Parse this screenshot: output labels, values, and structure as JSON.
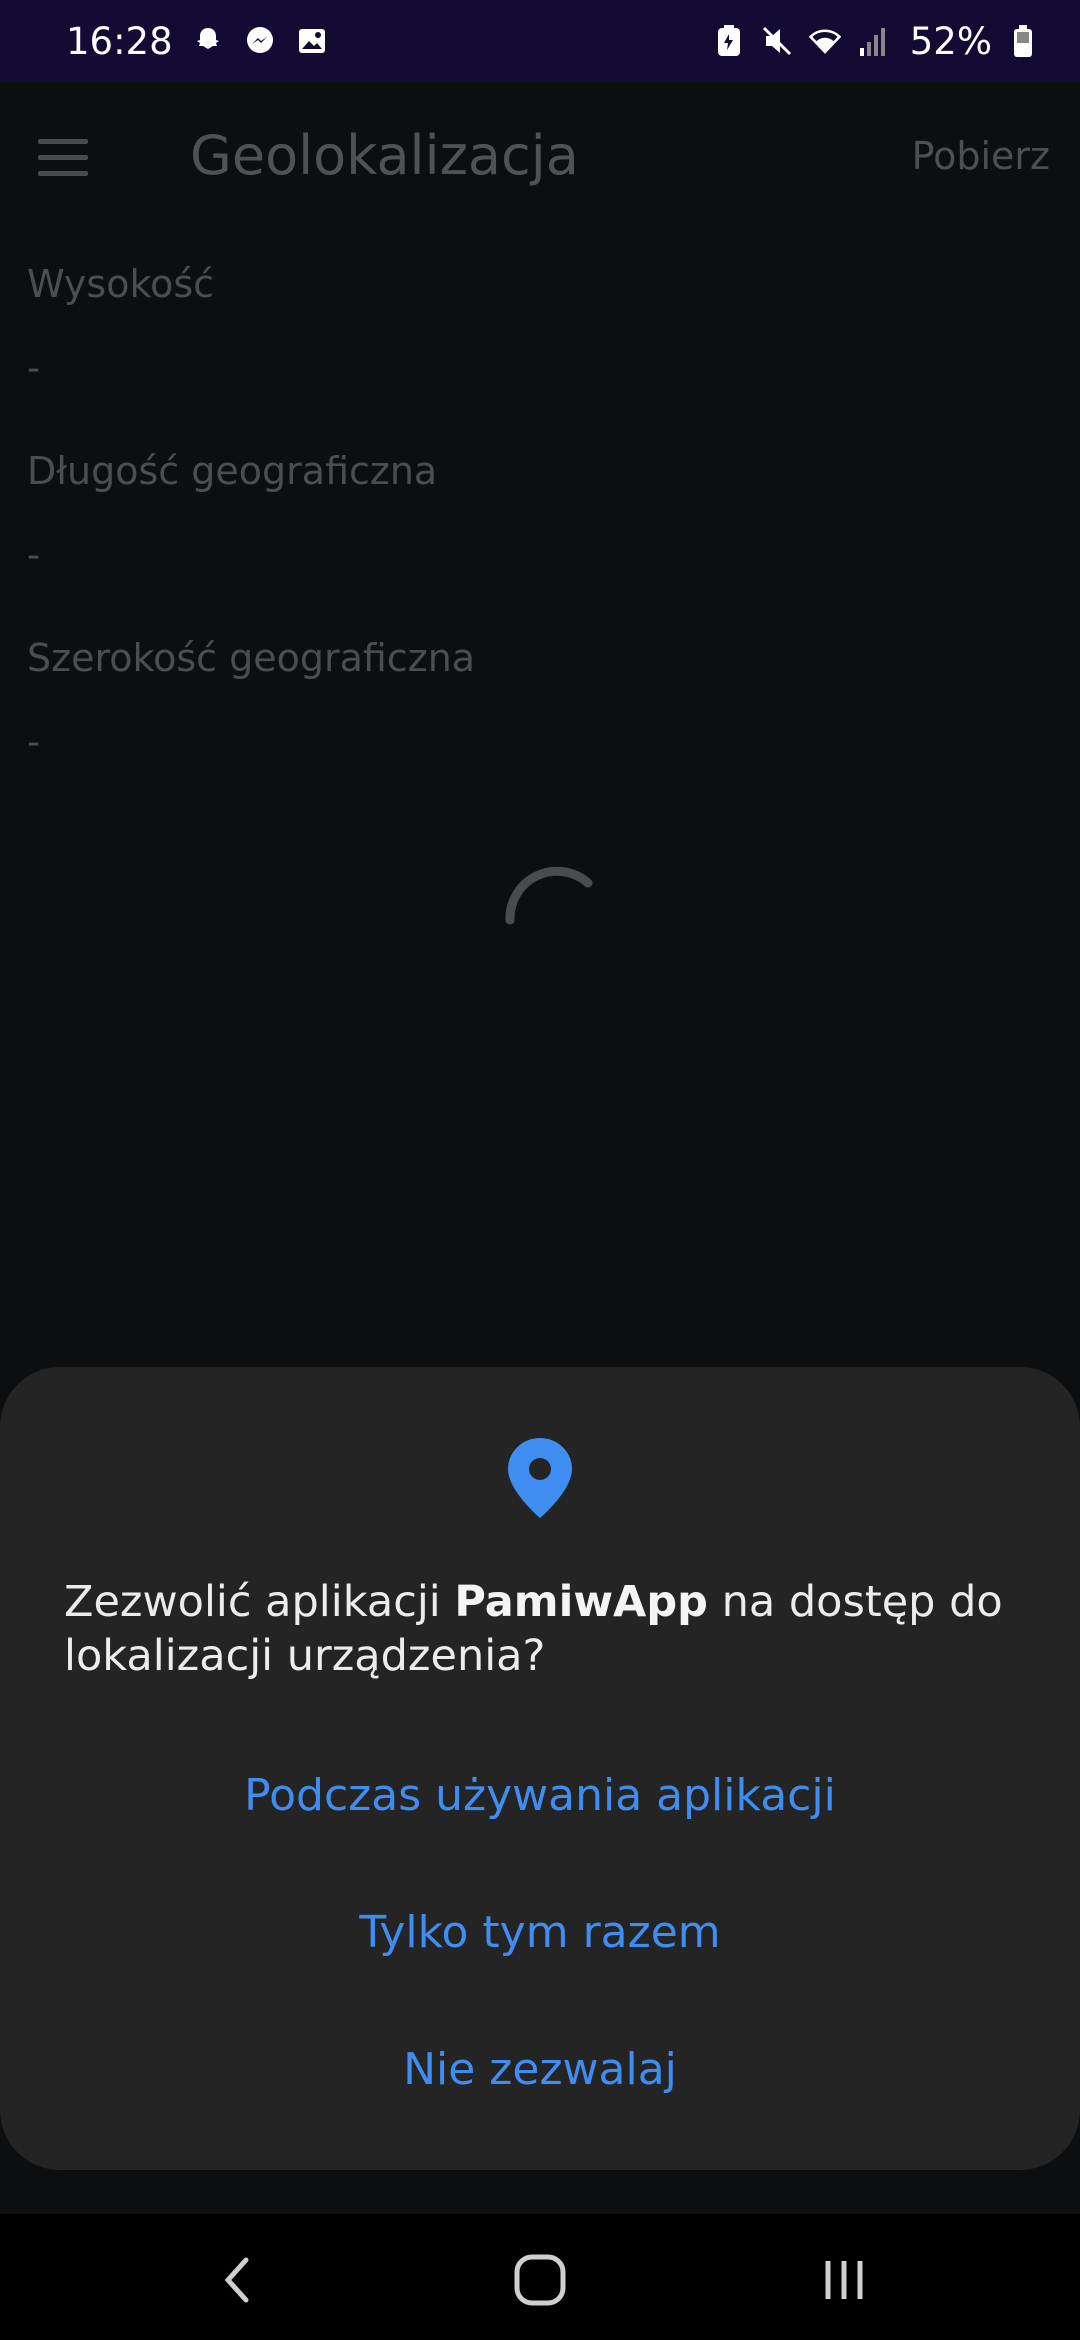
{
  "status_bar": {
    "time": "16:28",
    "battery_percent": "52%",
    "icons": [
      "snapchat-icon",
      "messenger-icon",
      "gallery-icon",
      "battery-saver-icon",
      "mute-icon",
      "wifi-icon",
      "signal-icon",
      "battery-icon"
    ]
  },
  "app_bar": {
    "title": "Geolokalizacja",
    "action": "Pobierz"
  },
  "fields": [
    {
      "label": "Wysokość",
      "value": "-"
    },
    {
      "label": "Długość geograficzna",
      "value": "-"
    },
    {
      "label": "Szerokość geograficzna",
      "value": "-"
    }
  ],
  "dialog": {
    "prompt_before": "Zezwolić aplikacji ",
    "app_name": "PamiwApp",
    "prompt_after": " na dostęp do lokalizacji urządzenia?",
    "options": [
      "Podczas używania aplikacji",
      "Tylko tym razem",
      "Nie zezwalaj"
    ]
  },
  "colors": {
    "accent": "#3f8df0",
    "sheet_bg": "#242424",
    "status_bar_bg": "#130b33",
    "page_bg": "#0d0e10"
  }
}
